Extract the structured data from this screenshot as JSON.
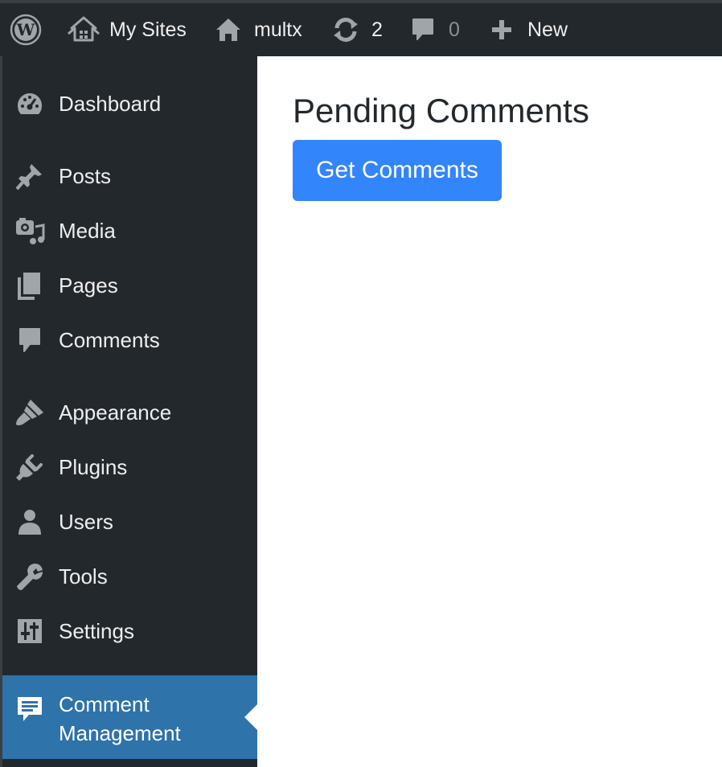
{
  "adminbar": {
    "wp_logo_icon": "wordpress-logo",
    "my_sites": {
      "icon": "my-sites-icon",
      "label": "My Sites"
    },
    "site": {
      "icon": "home-icon",
      "label": "multx"
    },
    "updates": {
      "icon": "updates-icon",
      "count": "2"
    },
    "comments": {
      "icon": "comment-bubble-icon",
      "count": "0"
    },
    "new": {
      "icon": "plus-icon",
      "label": "New"
    }
  },
  "sidebar": {
    "items": [
      {
        "icon": "dashboard-icon",
        "label": "Dashboard"
      },
      {
        "icon": "pin-icon",
        "label": "Posts"
      },
      {
        "icon": "media-icon",
        "label": "Media"
      },
      {
        "icon": "pages-icon",
        "label": "Pages"
      },
      {
        "icon": "comments-icon",
        "label": "Comments"
      },
      {
        "icon": "appearance-icon",
        "label": "Appearance"
      },
      {
        "icon": "plugins-icon",
        "label": "Plugins"
      },
      {
        "icon": "users-icon",
        "label": "Users"
      },
      {
        "icon": "tools-icon",
        "label": "Tools"
      },
      {
        "icon": "settings-icon",
        "label": "Settings"
      },
      {
        "icon": "comment-management-icon",
        "label_line1": "Comment",
        "label_line2": "Management",
        "current": true
      }
    ]
  },
  "main": {
    "title": "Pending Comments",
    "get_comments_label": "Get Comments"
  },
  "colors": {
    "adminbar_bg": "#23282d",
    "sidebar_bg": "#23282d",
    "current_item_bg": "#2e73aa",
    "button_bg": "#3385fb",
    "icon_gray": "#a0a5aa"
  }
}
